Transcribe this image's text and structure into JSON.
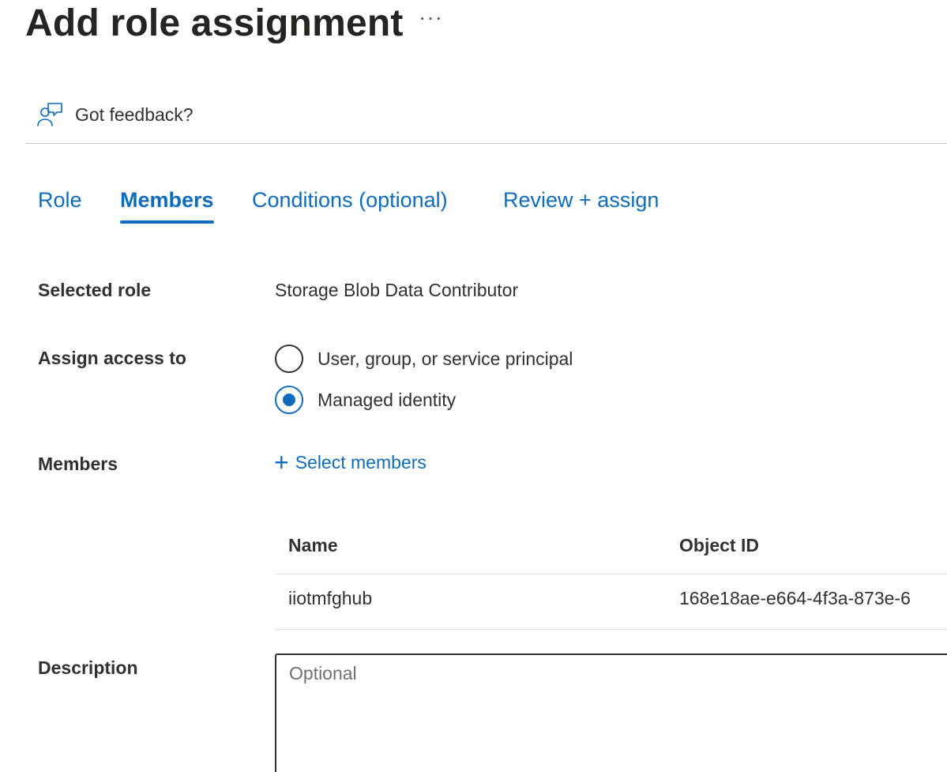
{
  "header": {
    "title": "Add role assignment",
    "more_label": "···"
  },
  "toolbar": {
    "feedback_label": "Got feedback?"
  },
  "tabs": [
    {
      "label": "Role",
      "active": false
    },
    {
      "label": "Members",
      "active": true
    },
    {
      "label": "Conditions (optional)",
      "active": false
    },
    {
      "label": "Review + assign",
      "active": false
    }
  ],
  "form": {
    "selected_role_label": "Selected role",
    "selected_role_value": "Storage Blob Data Contributor",
    "assign_access_label": "Assign access to",
    "assign_options": [
      {
        "label": "User, group, or service principal",
        "checked": false
      },
      {
        "label": "Managed identity",
        "checked": true
      }
    ],
    "members_label": "Members",
    "select_members_label": "Select members",
    "description_label": "Description",
    "description_placeholder": "Optional",
    "description_value": ""
  },
  "members_table": {
    "columns": [
      "Name",
      "Object ID"
    ],
    "rows": [
      [
        "iiotmfghub",
        "168e18ae-e664-4f3a-873e-6"
      ]
    ]
  },
  "colors": {
    "accent": "#0f6cbd",
    "text": "#323130",
    "divider": "#c8c6c4"
  },
  "icons": {
    "feedback": "person-feedback-icon",
    "add": "plus-icon",
    "more": "ellipsis-icon"
  }
}
